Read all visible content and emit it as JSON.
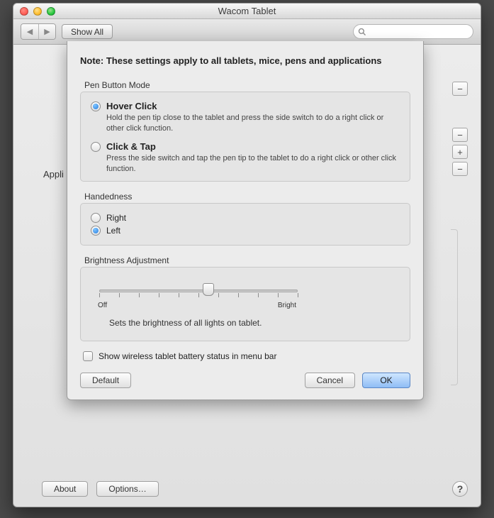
{
  "window": {
    "title": "Wacom Tablet",
    "show_all": "Show All"
  },
  "sheet": {
    "note": "Note: These settings apply to all tablets, mice, pens and applications",
    "pen_button_mode": {
      "label": "Pen Button Mode",
      "hover": {
        "title": "Hover Click",
        "desc": "Hold the pen tip close to the tablet and press the side switch to do a right click or other click function.",
        "selected": true
      },
      "click_tap": {
        "title": "Click & Tap",
        "desc": "Press the side switch and tap the pen tip to the tablet to do a right click or other click function.",
        "selected": false
      }
    },
    "handedness": {
      "label": "Handedness",
      "right": "Right",
      "left": "Left",
      "selected": "left"
    },
    "brightness": {
      "label": "Brightness Adjustment",
      "min_label": "Off",
      "max_label": "Bright",
      "desc": "Sets the brightness of all lights on tablet.",
      "value_percent": 55,
      "ticks": 11
    },
    "wireless_checkbox": "Show wireless tablet battery status in menu bar",
    "buttons": {
      "default": "Default",
      "cancel": "Cancel",
      "ok": "OK"
    }
  },
  "background": {
    "application_label": "Appli"
  },
  "footer": {
    "about": "About",
    "options": "Options…"
  }
}
